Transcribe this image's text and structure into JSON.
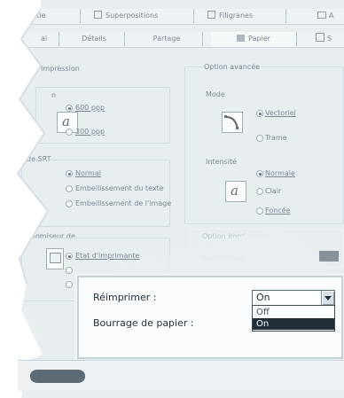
{
  "tabs_top": [
    "Sortie",
    "Superpositions",
    "Filigranes",
    "A"
  ],
  "tabs_second": [
    "al",
    "Détails",
    "Partage",
    "Papier",
    "S"
  ],
  "left": {
    "impression_title": "Impression",
    "resolution_title": "n",
    "res_options": [
      "600 ppp",
      "300 ppp"
    ],
    "sriT_title": "de SRT",
    "srt_options": [
      "Normal",
      "Embellissement du texte",
      "Embellissement de l'image"
    ],
    "economiseur_title": "onomiseur de",
    "eco_options": [
      "Etat d'imprimante",
      "",
      ""
    ]
  },
  "right": {
    "advanced_title": "Option avancée",
    "mode_title": "Mode",
    "mode_options": [
      "Vectoriel",
      "Trame"
    ],
    "intensity_title": "Intensité",
    "intensity_options": [
      "Normale",
      "Clair",
      "Foncée"
    ],
    "greyed_title": "Option imprimante",
    "greyed_item": "Réimprimer:"
  },
  "zoom": {
    "reimprimer_label": "Réimprimer :",
    "bourrage_label": "Bourrage de papier :",
    "select_value": "On",
    "options": [
      "Off",
      "On"
    ]
  },
  "colors": {
    "accent": "#1f2e39",
    "background": "#dfe6ea"
  },
  "icons": [
    "print-quality-icon",
    "printer-icon",
    "curve-icon",
    "quality-icon",
    "dropdown-arrow-icon",
    "samsung-logo"
  ]
}
